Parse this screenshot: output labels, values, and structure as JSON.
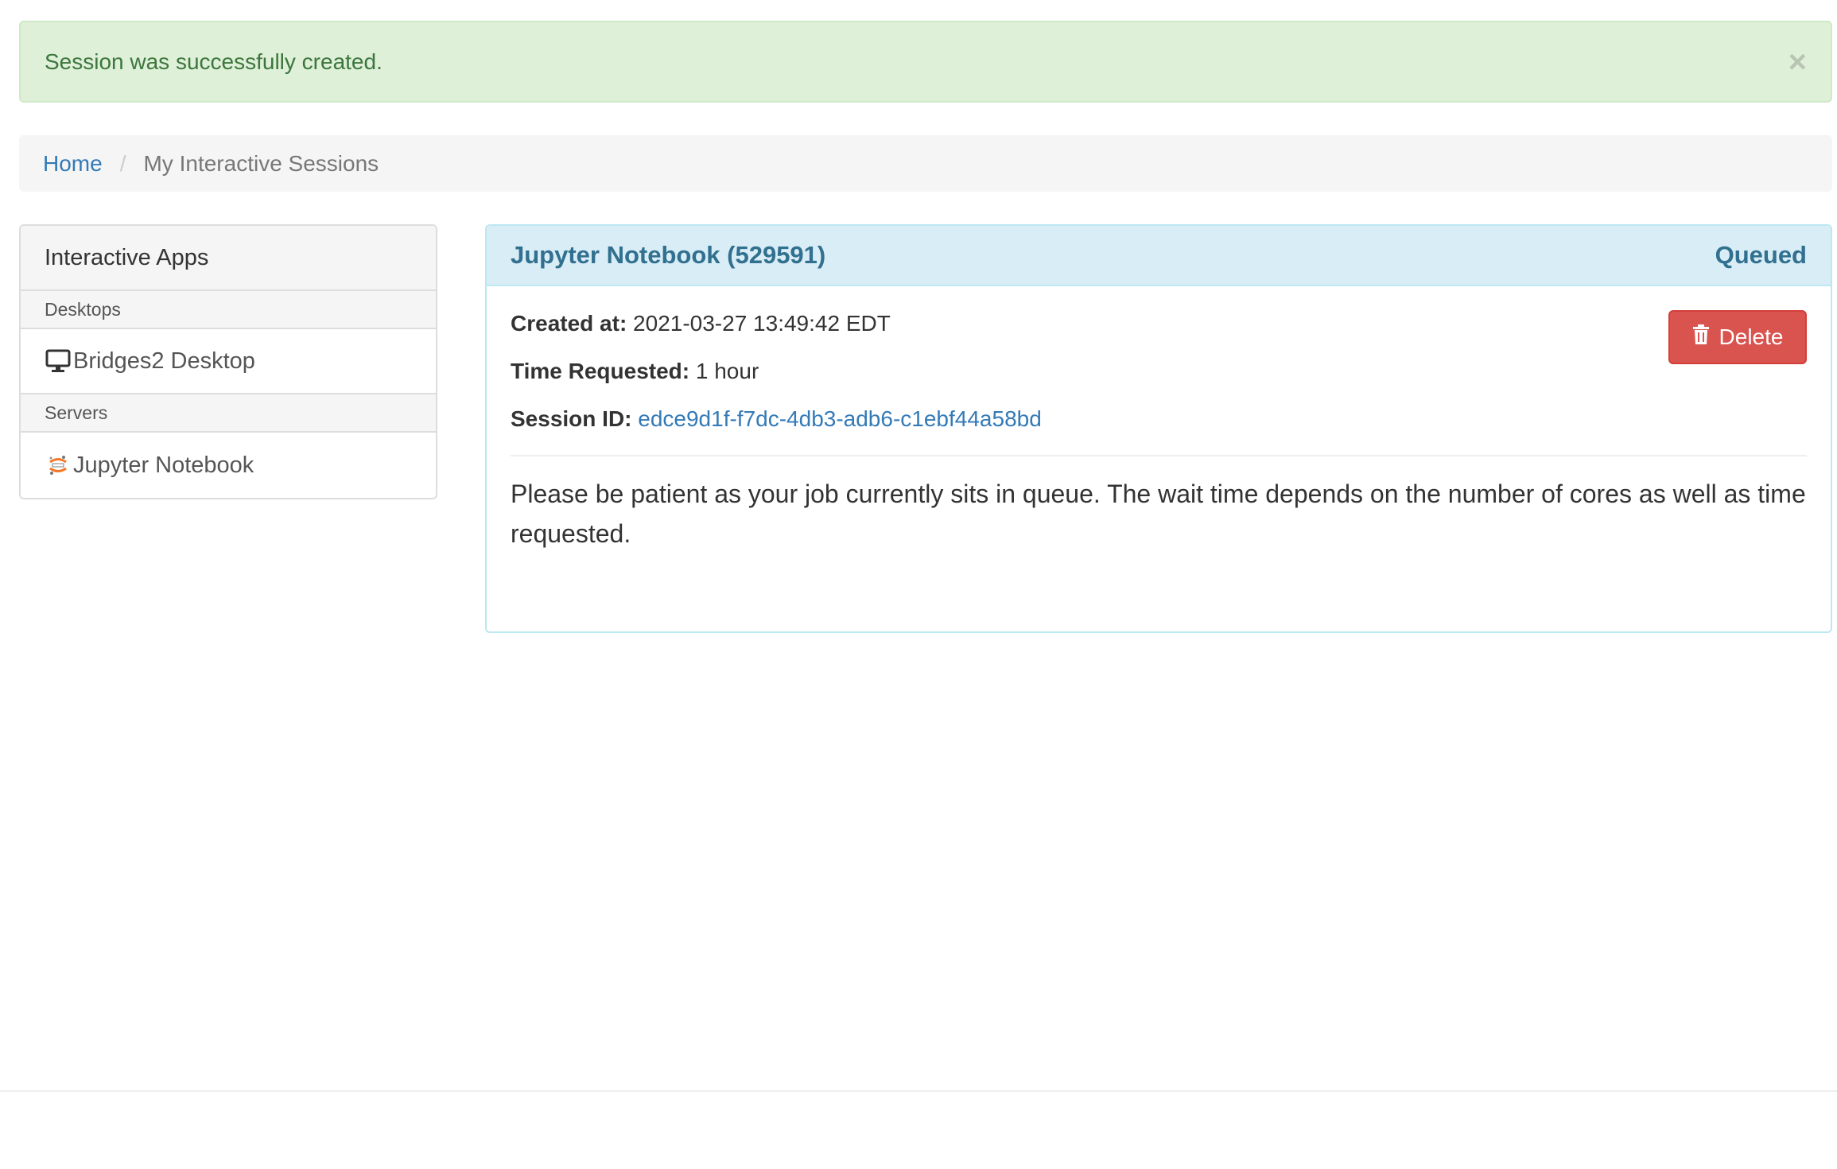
{
  "alert": {
    "message": "Session was successfully created.",
    "close_label": "×"
  },
  "breadcrumb": {
    "items": [
      {
        "label": "Home"
      },
      {
        "label": "My Interactive Sessions"
      }
    ],
    "separator": "/"
  },
  "sidebar": {
    "heading": "Interactive Apps",
    "sections": [
      {
        "label": "Desktops",
        "items": [
          {
            "label": "Bridges2 Desktop",
            "icon": "desktop-icon"
          }
        ]
      },
      {
        "label": "Servers",
        "items": [
          {
            "label": "Jupyter Notebook",
            "icon": "jupyter-icon"
          }
        ]
      }
    ]
  },
  "session": {
    "title": "Jupyter Notebook (529591)",
    "status": "Queued",
    "created_label": "Created at:",
    "created_value": "2021-03-27 13:49:42 EDT",
    "time_label": "Time Requested:",
    "time_value": "1 hour",
    "id_label": "Session ID:",
    "id_value": "edce9d1f-f7dc-4db3-adb6-c1ebf44a58bd",
    "delete_label": "Delete",
    "notice": "Please be patient as your job currently sits in queue. The wait time depends on the number of cores as well as time requested."
  },
  "colors": {
    "alert_bg": "#dff0d8",
    "alert_text": "#3c763d",
    "panel_heading_bg": "#d9edf7",
    "panel_heading_text": "#31708f",
    "link": "#337ab7",
    "danger": "#d9534f"
  }
}
